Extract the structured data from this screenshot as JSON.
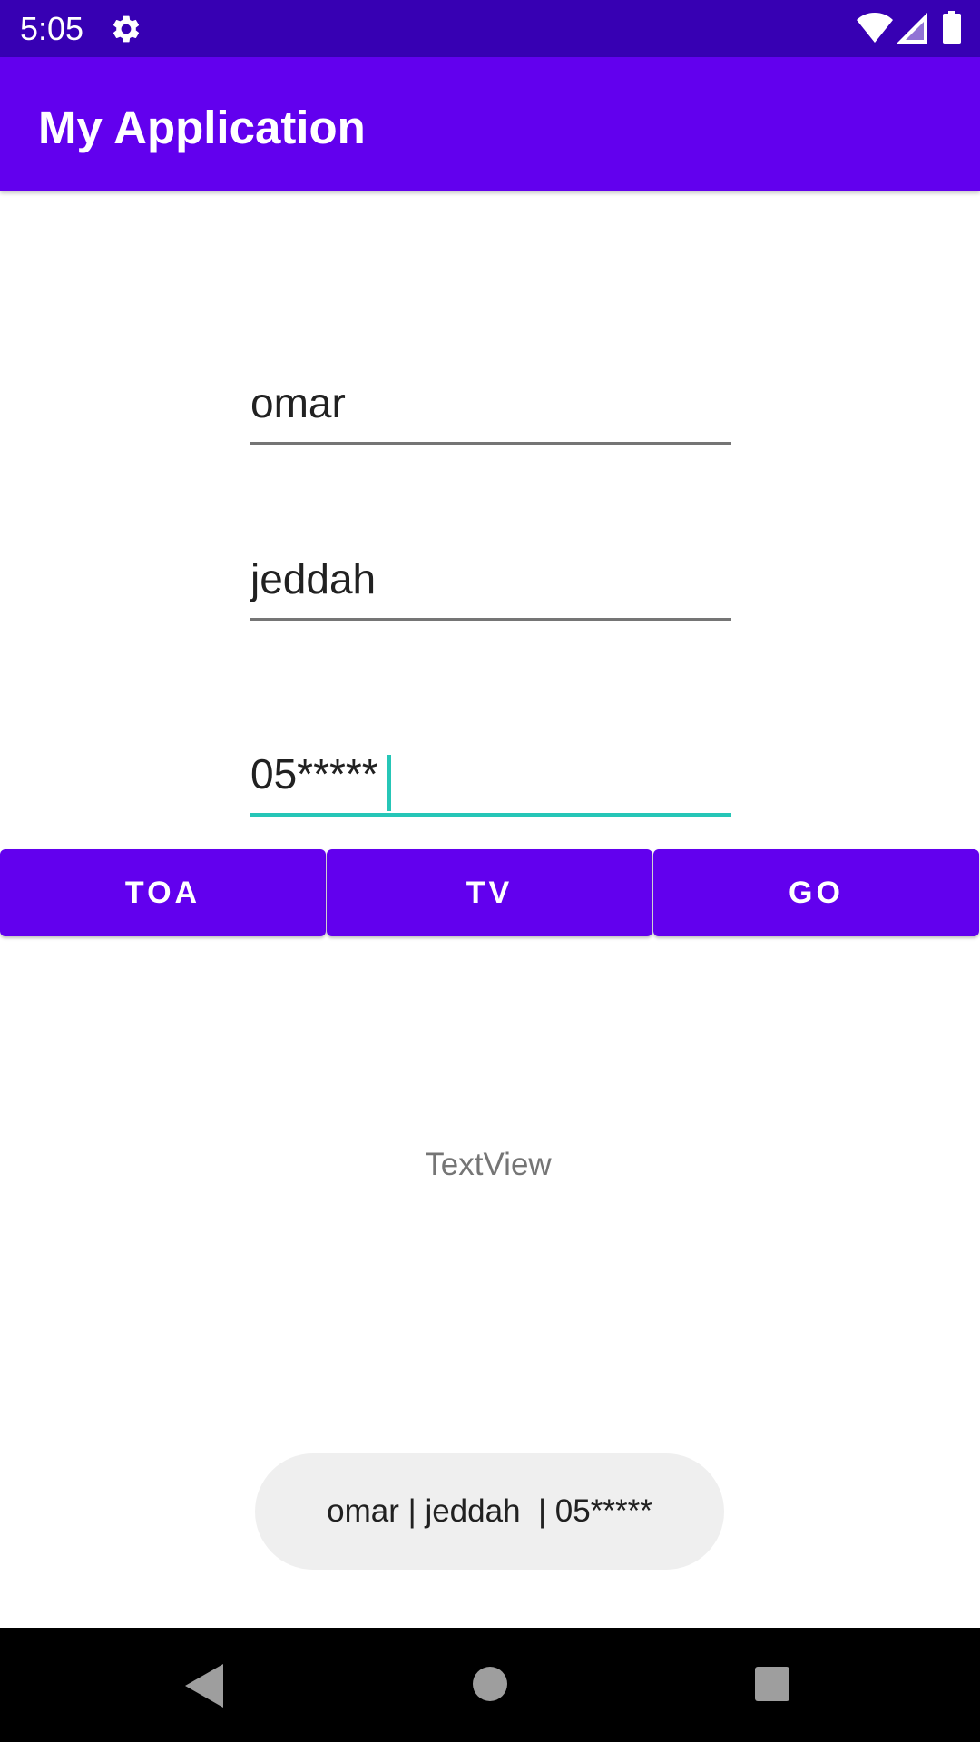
{
  "status_bar": {
    "time": "5:05",
    "icons": [
      "gear-icon",
      "wifi-icon",
      "signal-icon",
      "battery-icon"
    ],
    "background": "#3700b3"
  },
  "app_bar": {
    "title": "My Application",
    "background": "#6200ee"
  },
  "form": {
    "name_value": "omar",
    "city_value": "jeddah",
    "phone_value": "05*****",
    "accent_color": "#26c6b7"
  },
  "buttons": {
    "toa_label": "TOA",
    "tv_label": "TV",
    "go_label": "GO",
    "color": "#6200ee"
  },
  "textview": {
    "text": "TextView"
  },
  "toast": {
    "message": "omar | jeddah  | 05*****"
  },
  "nav_bar": {
    "icons": [
      "back-icon",
      "home-icon",
      "recents-icon"
    ]
  }
}
